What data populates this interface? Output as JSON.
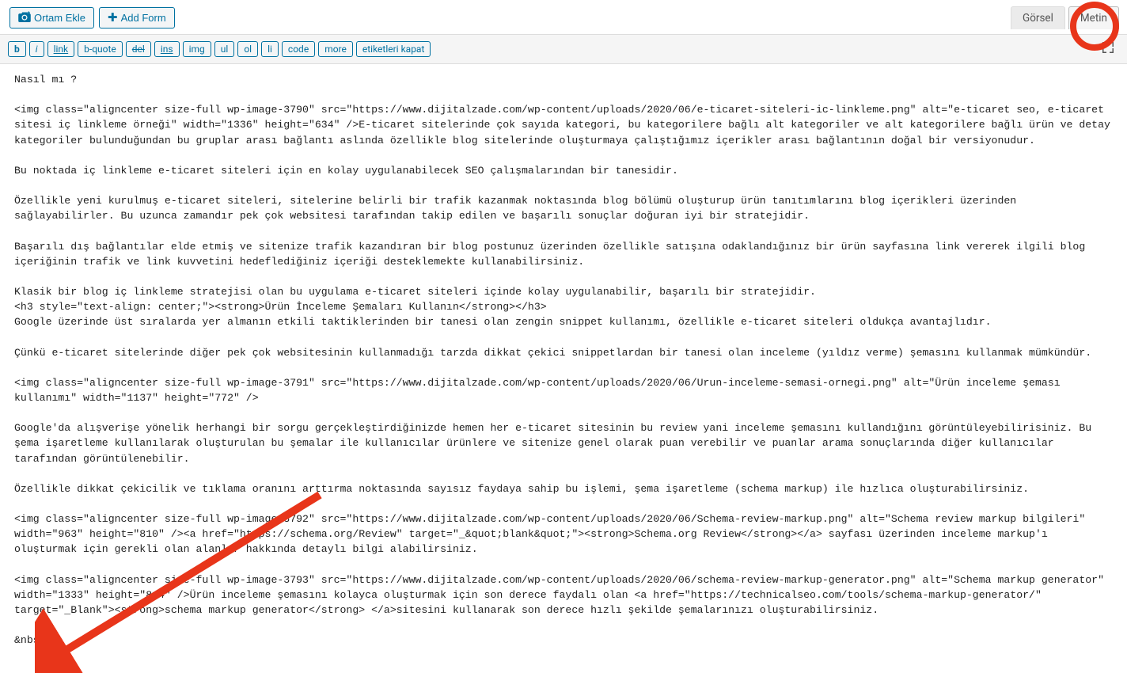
{
  "toolbar": {
    "ortam_ekle": "Ortam Ekle",
    "add_form": "Add Form"
  },
  "tabs": {
    "gorsel": "Görsel",
    "metin": "Metin"
  },
  "quicktags": {
    "b": "b",
    "i": "i",
    "link": "link",
    "bquote": "b-quote",
    "del": "del",
    "ins": "ins",
    "img": "img",
    "ul": "ul",
    "ol": "ol",
    "li": "li",
    "code": "code",
    "more": "more",
    "close_tags": "etiketleri kapat"
  },
  "editor_content": "Nasıl mı ?\n\n<img class=\"aligncenter size-full wp-image-3790\" src=\"https://www.dijitalzade.com/wp-content/uploads/2020/06/e-ticaret-siteleri-ic-linkleme.png\" alt=\"e-ticaret seo, e-ticaret sitesi iç linkleme örneği\" width=\"1336\" height=\"634\" />E-ticaret sitelerinde çok sayıda kategori, bu kategorilere bağlı alt kategoriler ve alt kategorilere bağlı ürün ve detay kategoriler bulunduğundan bu gruplar arası bağlantı aslında özellikle blog sitelerinde oluşturmaya çalıştığımız içerikler arası bağlantının doğal bir versiyonudur.\n\nBu noktada iç linkleme e-ticaret siteleri için en kolay uygulanabilecek SEO çalışmalarından bir tanesidir.\n\nÖzellikle yeni kurulmuş e-ticaret siteleri, sitelerine belirli bir trafik kazanmak noktasında blog bölümü oluşturup ürün tanıtımlarını blog içerikleri üzerinden sağlayabilirler. Bu uzunca zamandır pek çok websitesi tarafından takip edilen ve başarılı sonuçlar doğuran iyi bir stratejidir.\n\nBaşarılı dış bağlantılar elde etmiş ve sitenize trafik kazandıran bir blog postunuz üzerinden özellikle satışına odaklandığınız bir ürün sayfasına link vererek ilgili blog içeriğinin trafik ve link kuvvetini hedeflediğiniz içeriği desteklemekte kullanabilirsiniz.\n\nKlasik bir blog iç linkleme stratejisi olan bu uygulama e-ticaret siteleri içinde kolay uygulanabilir, başarılı bir stratejidir.\n<h3 style=\"text-align: center;\"><strong>Ürün İnceleme Şemaları Kullanın</strong></h3>\nGoogle üzerinde üst sıralarda yer almanın etkili taktiklerinden bir tanesi olan zengin snippet kullanımı, özellikle e-ticaret siteleri oldukça avantajlıdır.\n\nÇünkü e-ticaret sitelerinde diğer pek çok websitesinin kullanmadığı tarzda dikkat çekici snippetlardan bir tanesi olan inceleme (yıldız verme) şemasını kullanmak mümkündür.\n\n<img class=\"aligncenter size-full wp-image-3791\" src=\"https://www.dijitalzade.com/wp-content/uploads/2020/06/Urun-inceleme-semasi-ornegi.png\" alt=\"Ürün inceleme şeması kullanımı\" width=\"1137\" height=\"772\" />\n\nGoogle'da alışverişe yönelik herhangi bir sorgu gerçekleştirdiğinizde hemen her e-ticaret sitesinin bu review yani inceleme şemasını kullandığını görüntüleyebilirisiniz. Bu şema işaretleme kullanılarak oluşturulan bu şemalar ile kullanıcılar ürünlere ve sitenize genel olarak puan verebilir ve puanlar arama sonuçlarında diğer kullanıcılar tarafından görüntülenebilir.\n\nÖzellikle dikkat çekicilik ve tıklama oranını arttırma noktasında sayısız faydaya sahip bu işlemi, şema işaretleme (schema markup) ile hızlıca oluşturabilirsiniz.\n\n<img class=\"aligncenter size-full wp-image-3792\" src=\"https://www.dijitalzade.com/wp-content/uploads/2020/06/Schema-review-markup.png\" alt=\"Schema review markup bilgileri\" width=\"963\" height=\"810\" /><a href=\"https://schema.org/Review\" target=\"_&quot;blank&quot;\"><strong>Schema.org Review</strong></a> sayfası üzerinden inceleme markup'ı oluşturmak için gerekli olan alanlar hakkında detaylı bilgi alabilirsiniz.\n\n<img class=\"aligncenter size-full wp-image-3793\" src=\"https://www.dijitalzade.com/wp-content/uploads/2020/06/schema-review-markup-generator.png\" alt=\"Schema markup generator\" width=\"1333\" height=\"814\" />Ürün inceleme şemasını kolayca oluşturmak için son derece faydalı olan <a href=\"https://technicalseo.com/tools/schema-markup-generator/\" target=\"_Blank\"><strong>schema markup generator</strong> </a>sitesini kullanarak son derece hızlı şekilde şemalarınızı oluşturabilirsiniz.\n\n&nbsp;"
}
